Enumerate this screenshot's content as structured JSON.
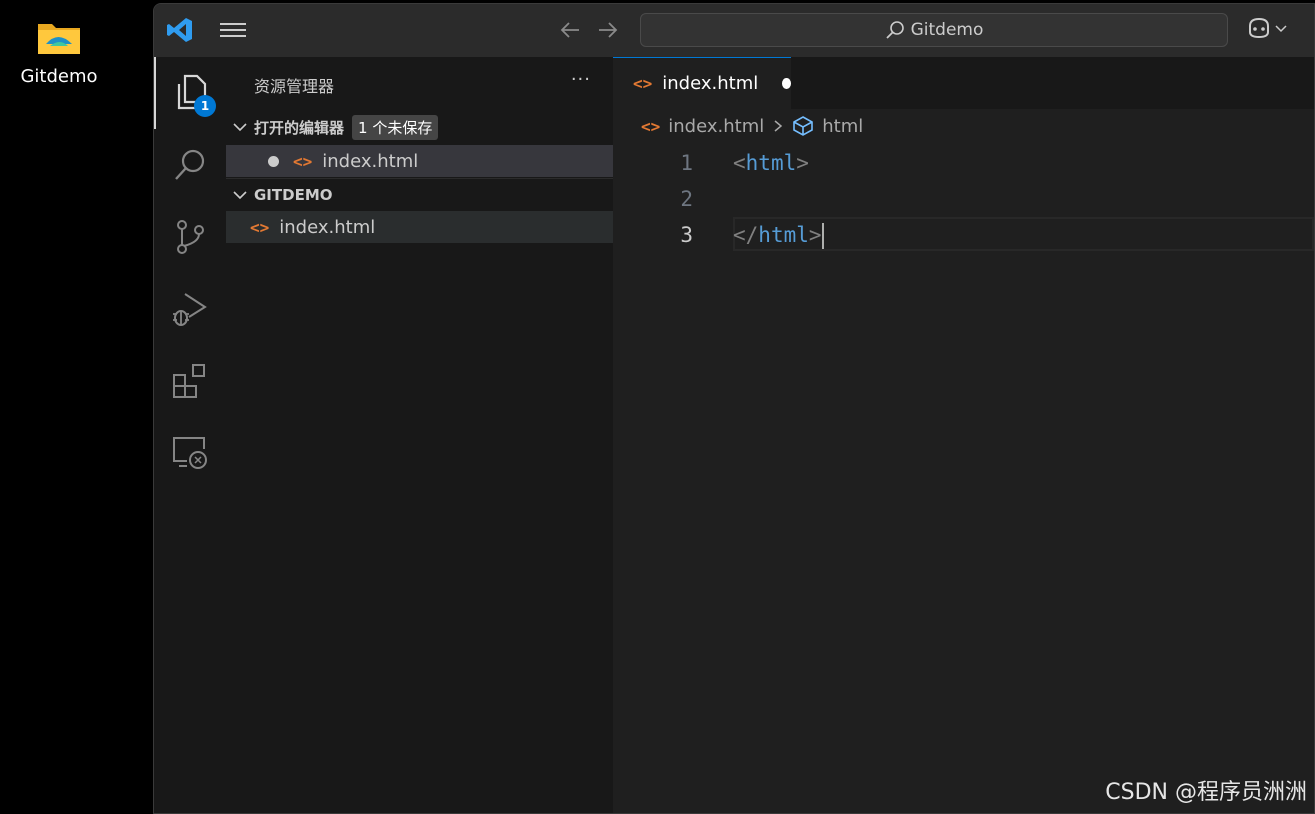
{
  "desktop": {
    "folder_label": "Gitdemo"
  },
  "titlebar": {
    "search_text": "Gitdemo"
  },
  "activity": {
    "explorer_badge": "1"
  },
  "sidebar": {
    "title": "资源管理器",
    "more": "···",
    "open_editors": {
      "label": "打开的编辑器",
      "unsaved": "1 个未保存",
      "file": "index.html"
    },
    "folder": {
      "label": "GITDEMO",
      "file": "index.html"
    }
  },
  "editor": {
    "tab": {
      "label": "index.html"
    },
    "breadcrumb": {
      "file": "index.html",
      "symbol": "html"
    },
    "lines": [
      {
        "num": "1",
        "open": "<",
        "tag": "html",
        "close": ">"
      },
      {
        "num": "2",
        "open": "",
        "tag": "",
        "close": ""
      },
      {
        "num": "3",
        "open": "</",
        "tag": "html",
        "close": ">"
      }
    ]
  },
  "watermark": "CSDN @程序员洲洲",
  "colors": {
    "accent": "#0078d4",
    "html_icon": "#e37933",
    "tag": "#569cd6"
  }
}
